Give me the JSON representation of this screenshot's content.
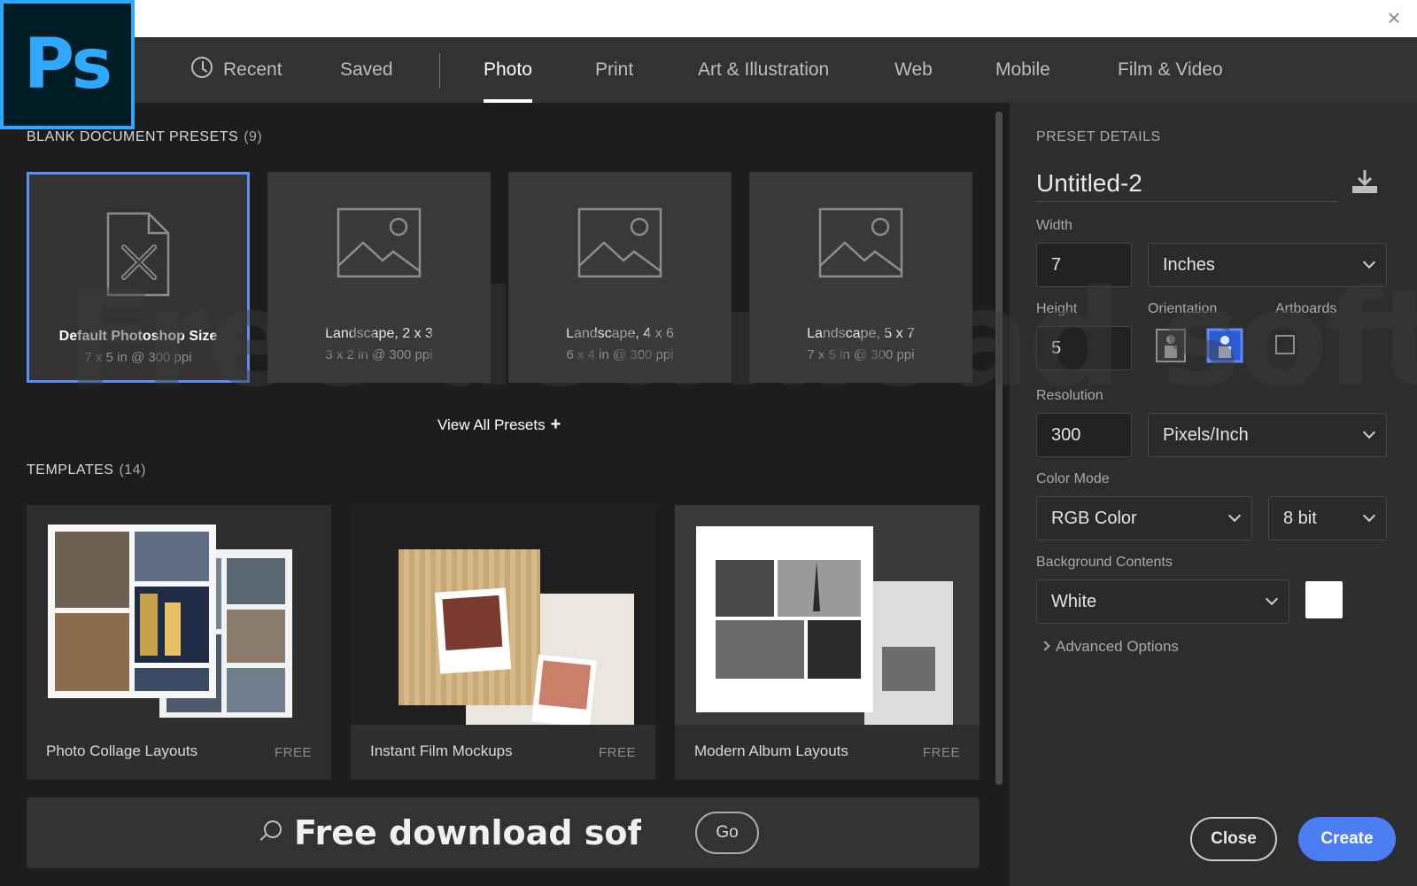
{
  "app": {
    "logo_text": "Ps",
    "close_glyph": "×"
  },
  "nav": {
    "tabs": [
      {
        "label": "Recent",
        "icon": "clock-icon"
      },
      {
        "label": "Saved"
      },
      {
        "label": "Photo",
        "active": true
      },
      {
        "label": "Print"
      },
      {
        "label": "Art & Illustration"
      },
      {
        "label": "Web"
      },
      {
        "label": "Mobile"
      },
      {
        "label": "Film & Video"
      }
    ]
  },
  "presets": {
    "title": "BLANK DOCUMENT PRESETS",
    "count": "(9)",
    "items": [
      {
        "name": "Default Photoshop Size",
        "size": "7 x 5 in @ 300 ppi",
        "icon": "document-tools-icon",
        "selected": true
      },
      {
        "name": "Landscape, 2 x 3",
        "size": "3 x 2 in @ 300 ppi",
        "icon": "image-icon"
      },
      {
        "name": "Landscape, 4 x 6",
        "size": "6 x 4 in @ 300 ppi",
        "icon": "image-icon"
      },
      {
        "name": "Landscape, 5 x 7",
        "size": "7 x 5 in @ 300 ppi",
        "icon": "image-icon"
      }
    ],
    "view_all": "View All Presets",
    "view_all_glyph": "+"
  },
  "templates": {
    "title": "TEMPLATES",
    "count": "(14)",
    "items": [
      {
        "name": "Photo Collage Layouts",
        "price": "FREE"
      },
      {
        "name": "Instant Film Mockups",
        "price": "FREE"
      },
      {
        "name": "Modern Album Layouts",
        "price": "FREE"
      }
    ]
  },
  "search": {
    "value": "Free download software",
    "go_label": "Go"
  },
  "details": {
    "title": "PRESET DETAILS",
    "doc_name": "Untitled-2",
    "width_label": "Width",
    "width_value": "7",
    "width_unit": "Inches",
    "height_label": "Height",
    "height_value": "5",
    "orientation_label": "Orientation",
    "artboards_label": "Artboards",
    "resolution_label": "Resolution",
    "resolution_value": "300",
    "resolution_unit": "Pixels/Inch",
    "color_mode_label": "Color Mode",
    "color_mode": "RGB Color",
    "bit_depth": "8 bit",
    "background_label": "Background Contents",
    "background": "White",
    "background_color": "#ffffff",
    "advanced_label": "Advanced Options",
    "close_label": "Close",
    "create_label": "Create"
  },
  "colors": {
    "accent": "#4c7ef3",
    "logo_blue": "#31a8ff"
  },
  "watermark": "Free download software"
}
